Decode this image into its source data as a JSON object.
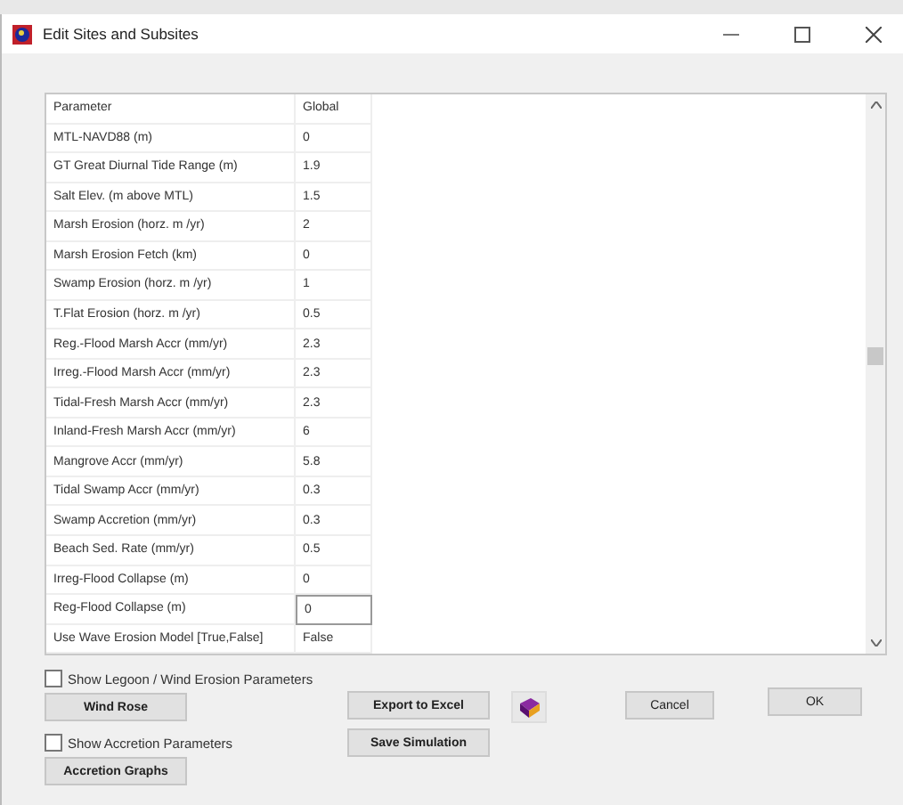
{
  "window": {
    "title": "Edit Sites and Subsites"
  },
  "table": {
    "columns": [
      "Parameter",
      "Global"
    ],
    "rows": [
      {
        "parameter": "MTL-NAVD88 (m)",
        "value": "0",
        "editing": false
      },
      {
        "parameter": "GT Great Diurnal Tide Range (m)",
        "value": "1.9",
        "editing": false
      },
      {
        "parameter": "Salt Elev. (m above MTL)",
        "value": "1.5",
        "editing": false
      },
      {
        "parameter": "Marsh Erosion (horz. m /yr)",
        "value": "2",
        "editing": false
      },
      {
        "parameter": "Marsh Erosion Fetch (km)",
        "value": "0",
        "editing": false
      },
      {
        "parameter": "Swamp Erosion (horz. m /yr)",
        "value": "1",
        "editing": false
      },
      {
        "parameter": "T.Flat Erosion (horz. m /yr)",
        "value": "0.5",
        "editing": false
      },
      {
        "parameter": "Reg.-Flood Marsh Accr (mm/yr)",
        "value": "2.3",
        "editing": false
      },
      {
        "parameter": "Irreg.-Flood Marsh Accr (mm/yr)",
        "value": "2.3",
        "editing": false
      },
      {
        "parameter": "Tidal-Fresh Marsh Accr (mm/yr)",
        "value": "2.3",
        "editing": false
      },
      {
        "parameter": "Inland-Fresh Marsh Accr (mm/yr)",
        "value": "6",
        "editing": false
      },
      {
        "parameter": "Mangrove Accr (mm/yr)",
        "value": "5.8",
        "editing": false
      },
      {
        "parameter": "Tidal Swamp Accr (mm/yr)",
        "value": "0.3",
        "editing": false
      },
      {
        "parameter": "Swamp Accretion (mm/yr)",
        "value": "0.3",
        "editing": false
      },
      {
        "parameter": "Beach Sed. Rate (mm/yr)",
        "value": "0.5",
        "editing": false
      },
      {
        "parameter": "Irreg-Flood Collapse (m)",
        "value": "0",
        "editing": false
      },
      {
        "parameter": "Reg-Flood Collapse (m)",
        "value": "0",
        "editing": true
      },
      {
        "parameter": "Use Wave Erosion Model [True,False]",
        "value": "False",
        "editing": false
      }
    ]
  },
  "options": [
    {
      "label": "Show Legoon / Wind Erosion Parameters",
      "checked": false,
      "button": "Wind Rose"
    },
    {
      "label": "Show Accretion Parameters",
      "checked": false,
      "button": "Accretion Graphs"
    }
  ],
  "actions": {
    "export": "Export to Excel",
    "save": "Save Simulation",
    "cancel": "Cancel",
    "ok": "OK"
  }
}
